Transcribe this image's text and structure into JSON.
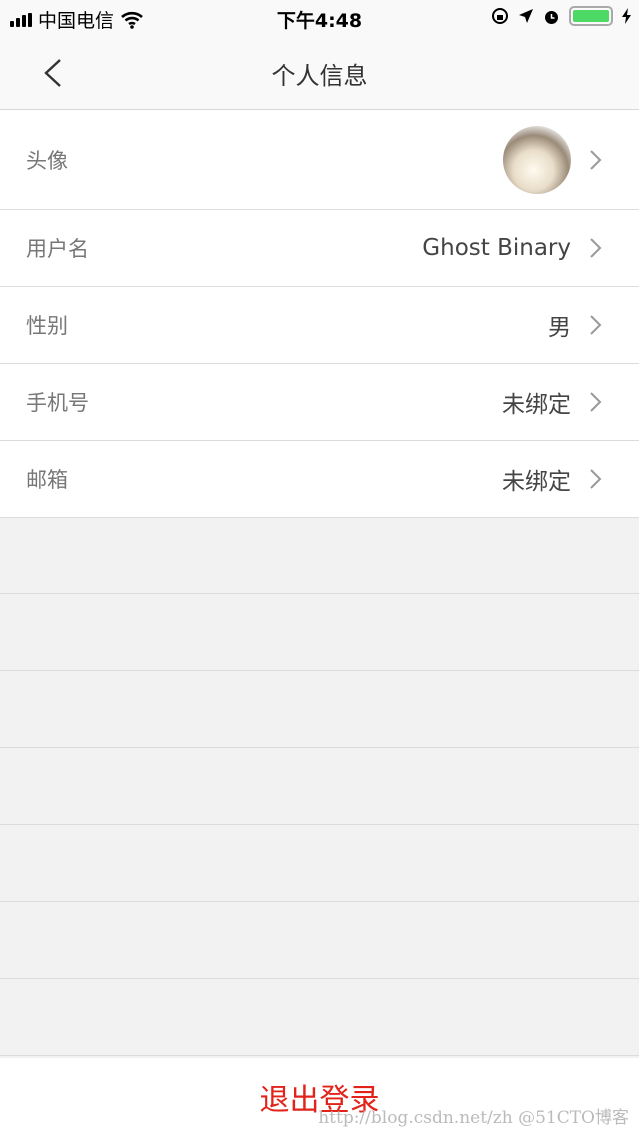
{
  "status_bar": {
    "carrier": "中国电信",
    "time": "下午4:48",
    "battery_percent": 100
  },
  "nav": {
    "title": "个人信息"
  },
  "rows": [
    {
      "label": "头像",
      "value": ""
    },
    {
      "label": "用户名",
      "value": "Ghost Binary"
    },
    {
      "label": "性别",
      "value": "男"
    },
    {
      "label": "手机号",
      "value": "未绑定"
    },
    {
      "label": "邮箱",
      "value": "未绑定"
    }
  ],
  "logout_label": "退出登录",
  "watermark": "http://blog.csdn.net/zh  @51CTO博客",
  "colors": {
    "accent": "#e2231a",
    "battery": "#4cd964"
  }
}
